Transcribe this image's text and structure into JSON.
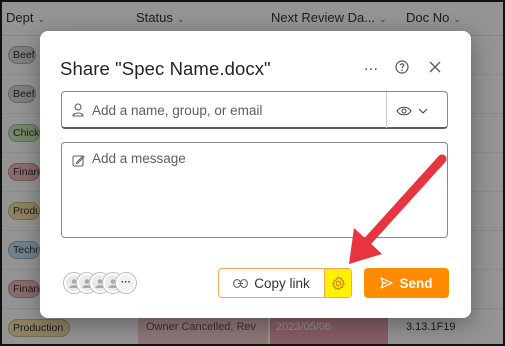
{
  "list": {
    "columns": [
      "Dept",
      "Status",
      "Next Review Da...",
      "Doc No"
    ],
    "rows": [
      {
        "dept": "Beef",
        "dept_color": "#d9d9d9"
      },
      {
        "dept": "Beef",
        "dept_color": "#d9d9d9"
      },
      {
        "dept": "Chicke",
        "dept_color": "#cde8b5"
      },
      {
        "dept": "Financ",
        "dept_color": "#f2b8b8"
      },
      {
        "dept": "Produc",
        "dept_color": "#f6e0a8"
      },
      {
        "dept": "Techn",
        "dept_color": "#bfe0f2"
      },
      {
        "dept": "Financ",
        "dept_color": "#f2b8b8"
      },
      {
        "dept": "Production",
        "dept_color": "#f6e0a8",
        "status": "Owner Cancelled, Rev",
        "date": "2023/05/06",
        "doc": "3.13.1F19"
      }
    ]
  },
  "dialog": {
    "title": "Share \"Spec Name.docx\"",
    "to_placeholder": "Add a name, group, or email",
    "message_placeholder": "Add a message",
    "more_label": "…",
    "copy_link_label": "Copy link",
    "send_label": "Send",
    "avatars_more": "···"
  },
  "colors": {
    "accent": "#ff8c00",
    "highlight": "#fff200",
    "arrow": "#e8343f"
  },
  "icons": {
    "more": "ellipsis-icon",
    "help": "help-icon",
    "close": "close-icon",
    "person": "person-icon",
    "eye": "eye-icon",
    "chevron": "chevron-down-icon",
    "pen": "pencil-icon",
    "link": "link-icon",
    "gear": "gear-icon",
    "send": "send-icon"
  }
}
